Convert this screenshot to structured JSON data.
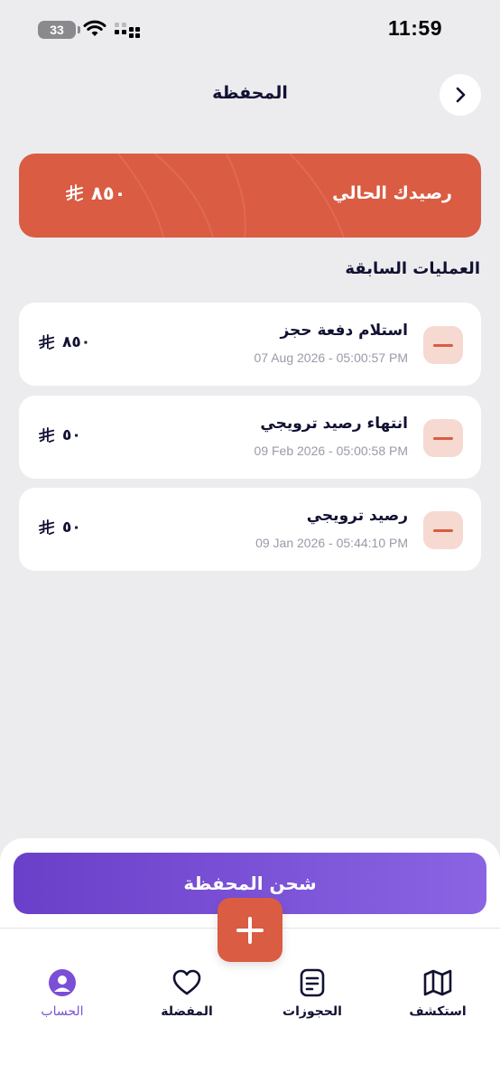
{
  "status_bar": {
    "time": "11:59",
    "battery": "33"
  },
  "header": {
    "title": "المحفظة"
  },
  "balance": {
    "label": "رصيدك الحالي",
    "amount": "٨٥٠"
  },
  "transactions_title": "العمليات السابقة",
  "transactions": [
    {
      "title": "استلام دفعة حجز",
      "date": "07 Aug 2026 - 05:00:57 PM",
      "amount": "٨٥٠"
    },
    {
      "title": "انتهاء رصيد ترويجي",
      "date": "09 Feb 2026 - 05:00:58 PM",
      "amount": "٥٠"
    },
    {
      "title": "رصيد ترويجي",
      "date": "09 Jan 2026 - 05:44:10 PM",
      "amount": "٥٠"
    }
  ],
  "topup_button": "شحن المحفظة",
  "nav": {
    "account": "الحساب",
    "favorites": "المفضلة",
    "bookings": "الحجوزات",
    "explore": "استكشف"
  },
  "colors": {
    "accent": "#d95c43",
    "primary": "#7a4fd6",
    "background": "#ececee"
  },
  "icons": [
    "chevron-right-icon",
    "riyal-icon",
    "minus-icon",
    "plus-icon",
    "map-icon",
    "document-icon",
    "heart-icon",
    "user-icon",
    "wifi-icon",
    "signal-icon",
    "battery-icon"
  ]
}
